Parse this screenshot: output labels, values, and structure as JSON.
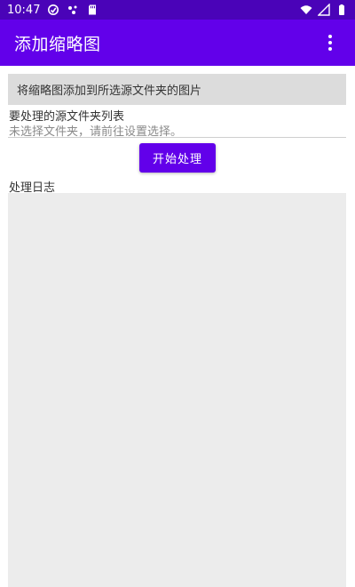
{
  "status_bar": {
    "time": "10:47",
    "icons_left": [
      "sync-icon",
      "dots-icon",
      "sd-card-icon"
    ],
    "icons_right": [
      "wifi-icon",
      "signal-icon",
      "battery-icon"
    ]
  },
  "app_bar": {
    "title": "添加缩略图",
    "menu_icon": "more-vert-icon"
  },
  "info_banner": "将缩略图添加到所选源文件夹的图片",
  "source_folders": {
    "label": "要处理的源文件夹列表",
    "empty_message": "未选择文件夹，请前往设置选择。"
  },
  "start_button": "开始处理",
  "log": {
    "label": "处理日志",
    "content": ""
  },
  "colors": {
    "status_bar": "#4a03b8",
    "app_bar": "#6200ea",
    "banner_bg": "#dcdcdc",
    "log_bg": "#ececec"
  }
}
